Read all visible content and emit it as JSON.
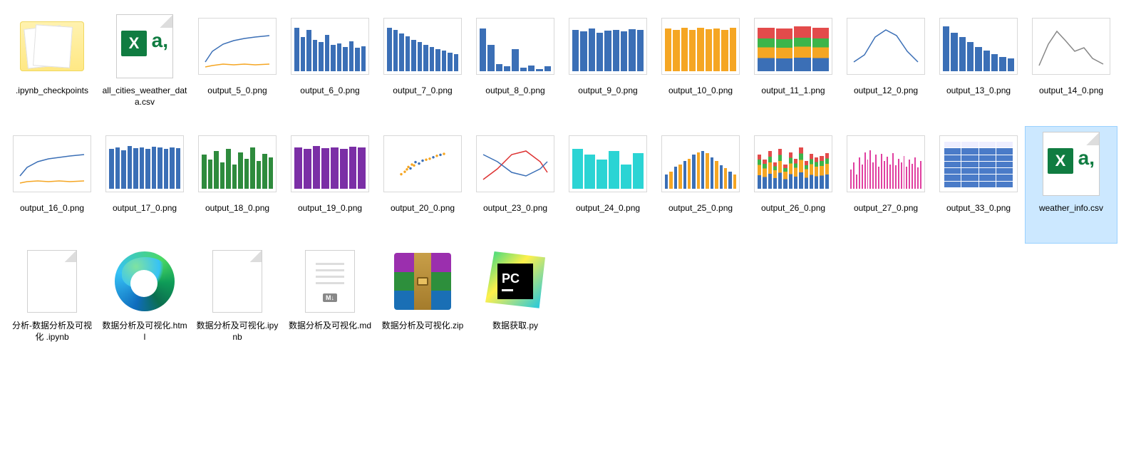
{
  "files": [
    {
      "name": ".ipynb_checkpoints",
      "type": "folder"
    },
    {
      "name": "all_cities_weather_data.csv",
      "type": "csv"
    },
    {
      "name": "output_5_0.png",
      "type": "chart",
      "chart": "line2"
    },
    {
      "name": "output_6_0.png",
      "type": "chart",
      "chart": "bars_blue_desc"
    },
    {
      "name": "output_7_0.png",
      "type": "chart",
      "chart": "bars_blue_desc2"
    },
    {
      "name": "output_8_0.png",
      "type": "chart",
      "chart": "bars_blue_sparse"
    },
    {
      "name": "output_9_0.png",
      "type": "chart",
      "chart": "bars_blue_even"
    },
    {
      "name": "output_10_0.png",
      "type": "chart",
      "chart": "bars_orange"
    },
    {
      "name": "output_11_1.png",
      "type": "chart",
      "chart": "stacked"
    },
    {
      "name": "output_12_0.png",
      "type": "chart",
      "chart": "line_peak"
    },
    {
      "name": "output_13_0.png",
      "type": "chart",
      "chart": "bars_blue_desc3"
    },
    {
      "name": "output_14_0.png",
      "type": "chart",
      "chart": "line_single"
    },
    {
      "name": "output_16_0.png",
      "type": "chart",
      "chart": "line2b"
    },
    {
      "name": "output_17_0.png",
      "type": "chart",
      "chart": "bars_blue_even2"
    },
    {
      "name": "output_18_0.png",
      "type": "chart",
      "chart": "bars_green"
    },
    {
      "name": "output_19_0.png",
      "type": "chart",
      "chart": "bars_purple"
    },
    {
      "name": "output_20_0.png",
      "type": "chart",
      "chart": "scatter"
    },
    {
      "name": "output_23_0.png",
      "type": "chart",
      "chart": "line_cross"
    },
    {
      "name": "output_24_0.png",
      "type": "chart",
      "chart": "bars_cyan"
    },
    {
      "name": "output_25_0.png",
      "type": "chart",
      "chart": "bars_mixed"
    },
    {
      "name": "output_26_0.png",
      "type": "chart",
      "chart": "stacked2"
    },
    {
      "name": "output_27_0.png",
      "type": "chart",
      "chart": "bars_magenta"
    },
    {
      "name": "output_33_0.png",
      "type": "chart",
      "chart": "table"
    },
    {
      "name": "weather_info.csv",
      "type": "csv",
      "selected": true
    },
    {
      "name": "分析-数据分析及可视化 .ipynb",
      "type": "blank"
    },
    {
      "name": "数据分析及可视化.html",
      "type": "edge"
    },
    {
      "name": "数据分析及可视化.ipynb",
      "type": "blank"
    },
    {
      "name": "数据分析及可视化.md",
      "type": "md"
    },
    {
      "name": "数据分析及可视化.zip",
      "type": "rar"
    },
    {
      "name": "数据获取.py",
      "type": "pycharm"
    }
  ],
  "icon_text": {
    "excel_x": "X",
    "excel_a": "a,",
    "md_badge": "M↓",
    "pycharm": "PC"
  }
}
